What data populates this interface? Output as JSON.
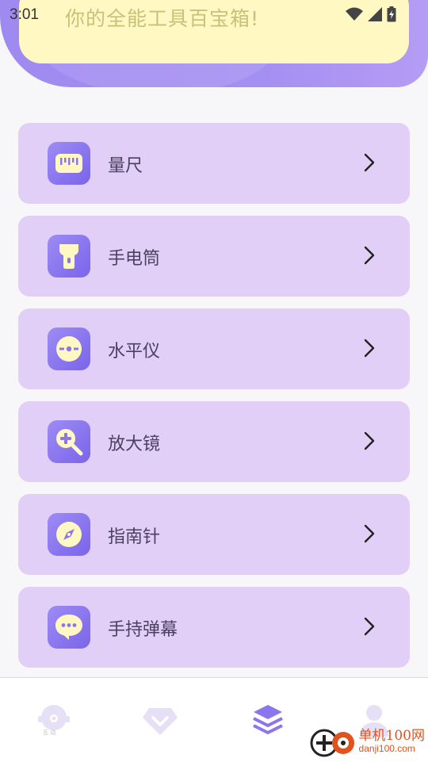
{
  "status_bar": {
    "time": "3:01"
  },
  "banner": {
    "text": "你的全能工具百宝箱!"
  },
  "tools": [
    {
      "label": "量尺",
      "icon": "ruler-icon"
    },
    {
      "label": "手电筒",
      "icon": "flashlight-icon"
    },
    {
      "label": "水平仪",
      "icon": "level-icon"
    },
    {
      "label": "放大镜",
      "icon": "magnifier-icon"
    },
    {
      "label": "指南针",
      "icon": "compass-icon"
    },
    {
      "label": "手持弹幕",
      "icon": "chat-bubble-icon"
    }
  ],
  "bottom_nav": {
    "items": [
      {
        "icon": "robot-icon",
        "caption": "互 动"
      },
      {
        "icon": "diamond-icon"
      },
      {
        "icon": "layers-icon",
        "active": true
      },
      {
        "icon": "user-icon"
      }
    ]
  },
  "watermark": {
    "line1": "单机100网",
    "line2": "danji100.com"
  },
  "colors": {
    "accent": "#8b76ee",
    "card": "#e2cff7",
    "banner": "#fff8c2",
    "inactive_nav": "#e6e0f6"
  }
}
